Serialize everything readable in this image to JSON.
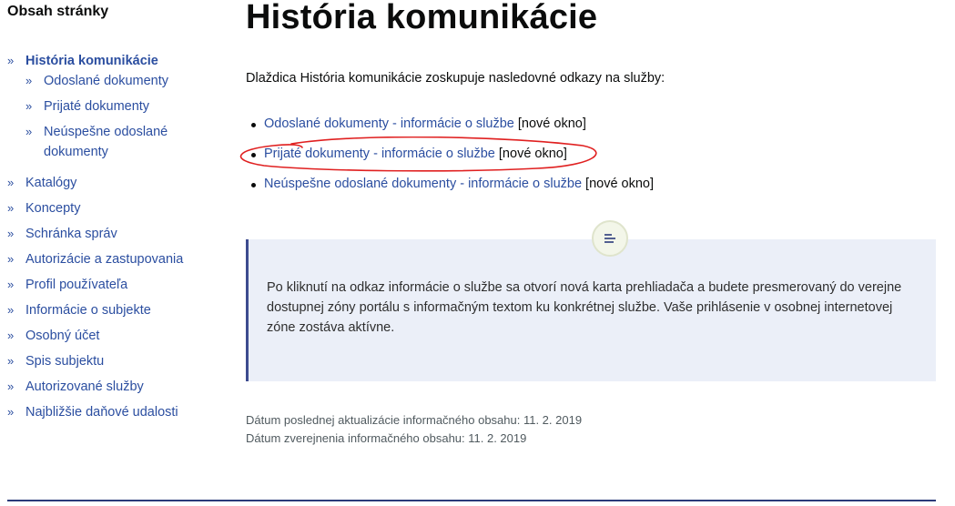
{
  "sidebar": {
    "title": "Obsah stránky",
    "active_item": {
      "chevron": "»",
      "label": "História komunikácie"
    },
    "sub_items": [
      {
        "label": "Odoslané dokumenty"
      },
      {
        "label": "Prijaté dokumenty"
      },
      {
        "label": "Neúspešne odoslané dokumenty"
      }
    ],
    "items": [
      {
        "label": "Katalógy"
      },
      {
        "label": "Koncepty"
      },
      {
        "label": "Schránka správ"
      },
      {
        "label": "Autorizácie a zastupovania"
      },
      {
        "label": "Profil používateľa"
      },
      {
        "label": "Informácie o subjekte"
      },
      {
        "label": "Osobný účet"
      },
      {
        "label": "Spis subjektu"
      },
      {
        "label": "Autorizované služby"
      },
      {
        "label": "Najbližšie daňové udalosti"
      }
    ]
  },
  "main": {
    "title": "História komunikácie",
    "intro": "Dlaždica História komunikácie zoskupuje nasledovné odkazy na služby:",
    "links": [
      {
        "text": "Odoslané dokumenty - informácie o službe",
        "suffix": "[nové okno]"
      },
      {
        "text": "Prijaté dokumenty - informácie o službe",
        "suffix": "[nové okno]"
      },
      {
        "text": "Neúspešne odoslané dokumenty - informácie o službe",
        "suffix": "[nové okno]"
      }
    ],
    "info_box": {
      "icon": "text-align-icon",
      "text": "Po kliknutí na odkaz informácie o službe sa otvorí nová karta prehliadača a budete presmerovaný do verejne dostupnej zóny portálu s informačným textom ku konkrétnej službe. Vaše prihlásenie v osobnej internetovej zóne zostáva aktívne."
    },
    "meta": {
      "updated": "Dátum poslednej aktualizácie informačného obsahu: 11. 2. 2019",
      "published": "Dátum zverejnenia informačného obsahu: 11. 2. 2019"
    }
  },
  "colors": {
    "link": "#2b4ea0",
    "info_bg": "#ebeff8",
    "info_border": "#3d4b8f",
    "annotation": "#e02020"
  }
}
